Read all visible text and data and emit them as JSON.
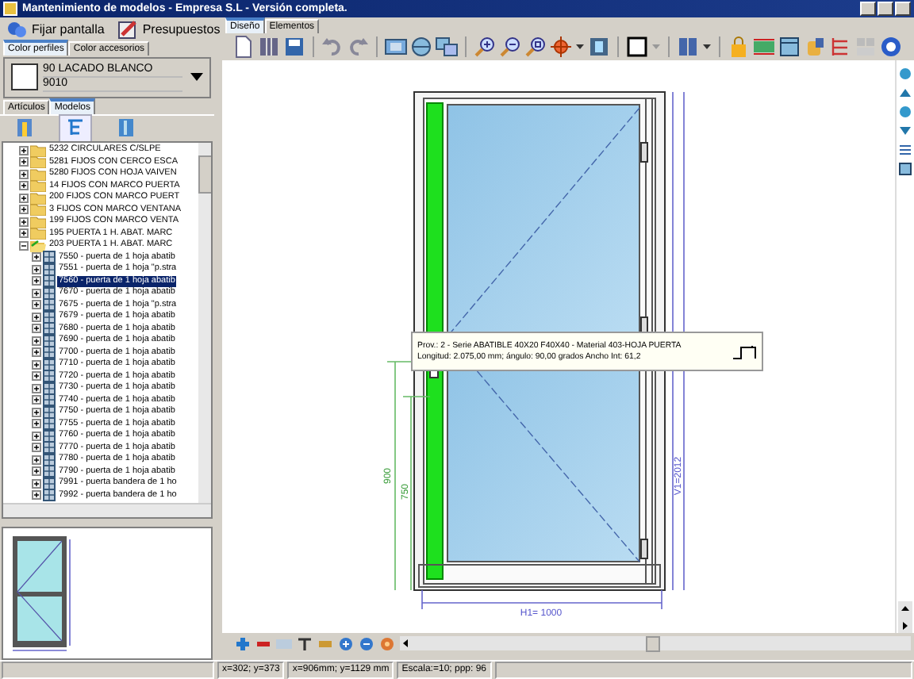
{
  "window": {
    "title": "Mantenimiento de modelos - Empresa S.L - Versión completa."
  },
  "top_buttons": [
    {
      "label": "Fijar pantalla"
    },
    {
      "label": "Presupuestos"
    }
  ],
  "color_tabs": [
    {
      "label": "Color perfiles",
      "selected": true
    },
    {
      "label": "Color accesorios",
      "selected": false
    }
  ],
  "color": {
    "name": "90 LACADO BLANCO",
    "code": "9010"
  },
  "tree_tabs": [
    {
      "label": "Artículos",
      "selected": false
    },
    {
      "label": "Modelos",
      "selected": true
    }
  ],
  "tree": [
    {
      "label": "5232 CIRCULARES C/SLPE",
      "expanded": false
    },
    {
      "label": "5281 FIJOS CON CERCO ESCA",
      "expanded": false
    },
    {
      "label": "5280 FIJOS CON HOJA VAIVEN",
      "expanded": false
    },
    {
      "label": "14 FIJOS CON MARCO PUERTA",
      "expanded": false
    },
    {
      "label": "200 FIJOS CON MARCO PUERT",
      "expanded": false
    },
    {
      "label": "3 FIJOS CON MARCO VENTANA",
      "expanded": false
    },
    {
      "label": "199 FIJOS CON MARCO VENTA",
      "expanded": false
    },
    {
      "label": "195 PUERTA 1 H. ABAT. MARC",
      "expanded": false
    },
    {
      "label": "203 PUERTA 1 H. ABAT. MARC",
      "expanded": true,
      "children": [
        {
          "label": "7550 - puerta de 1 hoja abatib",
          "selected": false
        },
        {
          "label": "7551 - puerta de 1 hoja \"p.stra",
          "selected": false
        },
        {
          "label": "7560 - puerta de 1 hoja abatib",
          "selected": true
        },
        {
          "label": "7670 - puerta de 1 hoja abatib",
          "selected": false
        },
        {
          "label": "7675 - puerta de 1 hoja \"p.stra",
          "selected": false
        },
        {
          "label": "7679 - puerta de 1 hoja abatib",
          "selected": false
        },
        {
          "label": "7680 - puerta de 1 hoja abatib",
          "selected": false
        },
        {
          "label": "7690 - puerta de 1 hoja abatib",
          "selected": false
        },
        {
          "label": "7700 - puerta de 1 hoja abatib",
          "selected": false
        },
        {
          "label": "7710 - puerta de 1 hoja abatib",
          "selected": false
        },
        {
          "label": "7720 - puerta de 1 hoja abatib",
          "selected": false
        },
        {
          "label": "7730 - puerta de 1 hoja abatib",
          "selected": false
        },
        {
          "label": "7740 - puerta de 1 hoja abatib",
          "selected": false
        },
        {
          "label": "7750 - puerta de 1 hoja abatib",
          "selected": false
        },
        {
          "label": "7755 - puerta de 1 hoja abatib",
          "selected": false
        },
        {
          "label": "7760 - puerta de 1 hoja abatib",
          "selected": false
        },
        {
          "label": "7770 - puerta de 1 hoja abatib",
          "selected": false
        },
        {
          "label": "7780 - puerta de 1 hoja abatib",
          "selected": false
        },
        {
          "label": "7790 - puerta de 1 hoja abatib",
          "selected": false
        },
        {
          "label": "7991 - puerta bandera de 1 ho",
          "selected": false
        },
        {
          "label": "7992 - puerta bandera de 1 ho",
          "selected": false
        }
      ]
    }
  ],
  "design_tabs": [
    {
      "label": "Diseño",
      "selected": true
    },
    {
      "label": "Elementos",
      "selected": false
    }
  ],
  "dimensions": {
    "left_outer": "900",
    "left_inner": "750",
    "right": "V1=2012",
    "bottom": "H1= 1000"
  },
  "tooltip": {
    "line_1": "Prov.: 2 - Serie ABATIBLE 40X20 F40X40 - Material 403-HOJA PUERTA",
    "line_2": "Longitud: 2.075,00 mm; ángulo: 90,00 grados  Ancho Int: 61,2"
  },
  "status_bar": [
    "x=302; y=373",
    "x=906mm; y=1129 mm",
    "Escala:=10; ppp: 96"
  ]
}
